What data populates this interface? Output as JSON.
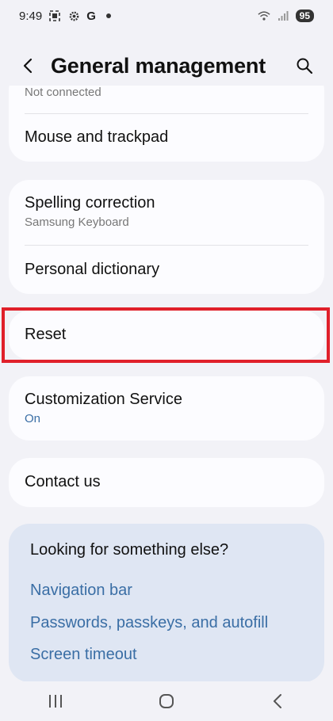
{
  "status": {
    "time": "9:49",
    "battery": "95",
    "g_label": "G"
  },
  "header": {
    "title": "General management"
  },
  "items": [
    {
      "title": "",
      "subtitle": "Not connected"
    },
    {
      "title": "Mouse and trackpad"
    },
    {
      "title": "Spelling correction",
      "subtitle": "Samsung Keyboard"
    },
    {
      "title": "Personal dictionary"
    },
    {
      "title": "Reset"
    },
    {
      "title": "Customization Service",
      "subtitle": "On"
    },
    {
      "title": "Contact us"
    }
  ],
  "looking": {
    "title": "Looking for something else?",
    "links": [
      "Navigation bar",
      "Passwords, passkeys, and autofill",
      "Screen timeout"
    ]
  },
  "colors": {
    "accent_blue": "#3a6ea5",
    "highlight_red": "#e0202a",
    "card_bg": "#fcfcff",
    "page_bg": "#f2f2f7"
  }
}
